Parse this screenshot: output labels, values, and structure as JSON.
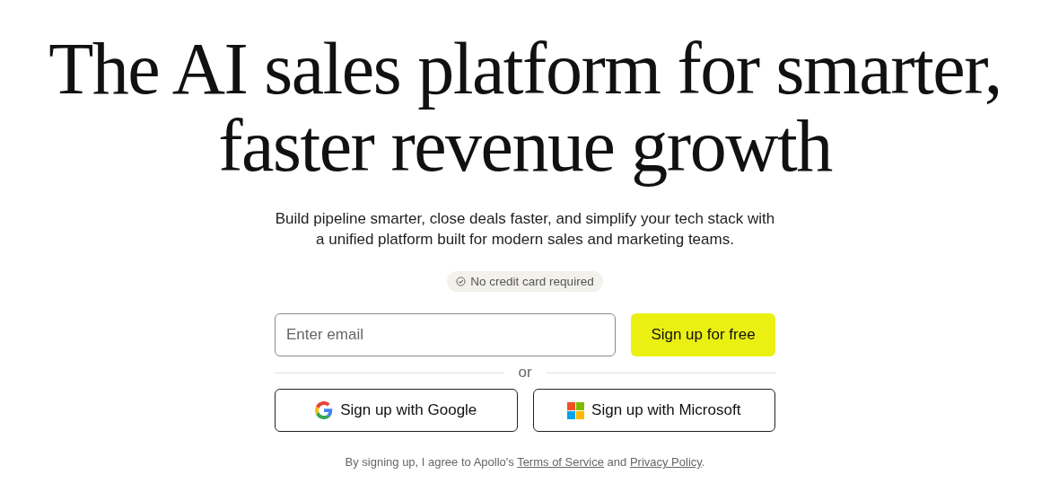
{
  "headline": [
    "The AI sales platform for smarter,",
    "faster revenue growth"
  ],
  "subtitle": "Build pipeline smarter, close deals faster, and simplify your tech stack with a unified platform built for modern sales and marketing teams.",
  "badge": "No credit card required",
  "email": {
    "placeholder": "Enter email"
  },
  "primary_button": "Sign up for free",
  "divider_text": "or",
  "social_buttons": [
    {
      "kind": "google",
      "label": "Sign up with Google"
    },
    {
      "kind": "microsoft",
      "label": "Sign up with Microsoft"
    }
  ],
  "legal": {
    "prefix": "By signing up, I agree to Apollo's",
    "terms_link": "Terms of Service",
    "middle": "and",
    "privacy_link": "Privacy Policy",
    "suffix": "."
  }
}
